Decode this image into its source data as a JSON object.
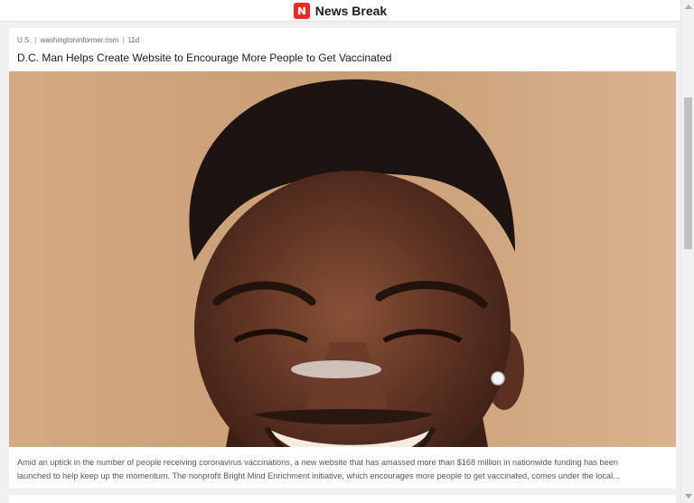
{
  "app": {
    "brand": "News Break",
    "logo_icon": "news-break-logo-icon",
    "accent_color": "#ee2a24"
  },
  "article": {
    "category": "U.S.",
    "source": "washingtoninformer.com",
    "age": "11d",
    "separator": "|",
    "headline": "D.C. Man Helps Create Website to Encourage More People to Get Vaccinated",
    "image": "portrait photo of a smiling man against a beige wall",
    "summary_line_1": "Amid an uptick in the number of people receiving coronavirus vaccinations, a new website that has amassed more than $168 million in nationwide funding has been",
    "summary_line_2": "launched to help keep up the momentum. The nonprofit Bright Mind Enrichment initiative, which encourages more people to get vaccinated, comes under the local..."
  }
}
